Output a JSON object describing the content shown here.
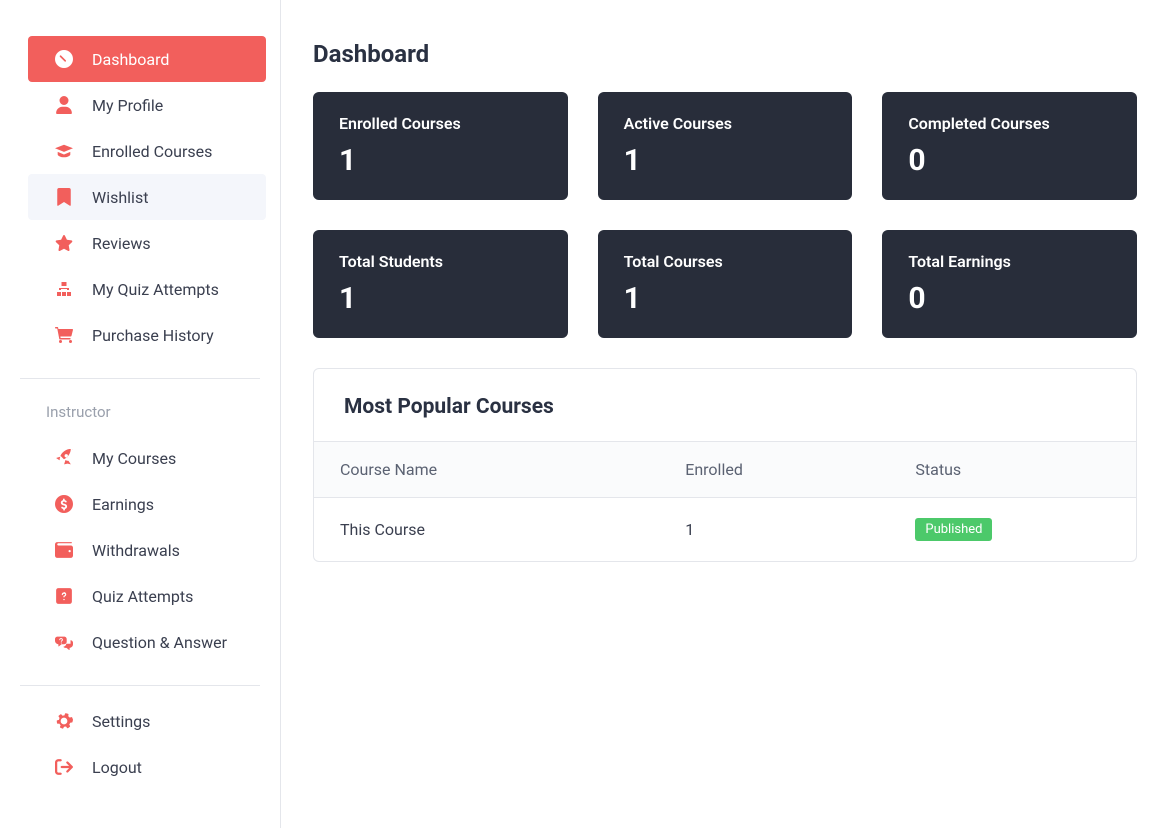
{
  "page": {
    "title": "Dashboard"
  },
  "sidebar": {
    "items": [
      {
        "label": "Dashboard"
      },
      {
        "label": "My Profile"
      },
      {
        "label": "Enrolled Courses"
      },
      {
        "label": "Wishlist"
      },
      {
        "label": "Reviews"
      },
      {
        "label": "My Quiz Attempts"
      },
      {
        "label": "Purchase History"
      }
    ],
    "section_title": "Instructor",
    "instructor_items": [
      {
        "label": "My Courses"
      },
      {
        "label": "Earnings"
      },
      {
        "label": "Withdrawals"
      },
      {
        "label": "Quiz Attempts"
      },
      {
        "label": "Question & Answer"
      }
    ],
    "footer_items": [
      {
        "label": "Settings"
      },
      {
        "label": "Logout"
      }
    ]
  },
  "stats": [
    {
      "label": "Enrolled Courses",
      "value": "1"
    },
    {
      "label": "Active Courses",
      "value": "1"
    },
    {
      "label": "Completed Courses",
      "value": "0"
    },
    {
      "label": "Total Students",
      "value": "1"
    },
    {
      "label": "Total Courses",
      "value": "1"
    },
    {
      "label": "Total Earnings",
      "value": "0"
    }
  ],
  "popular": {
    "title": "Most Popular Courses",
    "columns": [
      "Course Name",
      "Enrolled",
      "Status"
    ],
    "rows": [
      {
        "name": "This Course",
        "enrolled": "1",
        "status": "Published"
      }
    ]
  }
}
